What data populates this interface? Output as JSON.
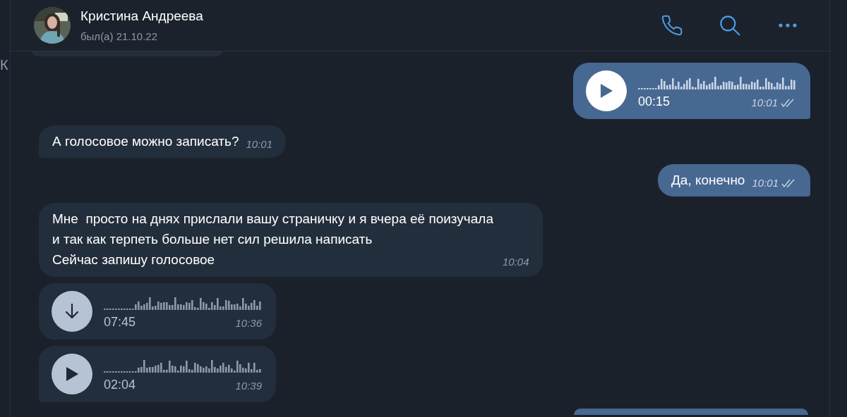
{
  "sidebar": {
    "text": "К"
  },
  "header": {
    "name": "Кристина Андреева",
    "status": "был(а) 21.10.22"
  },
  "messages": [
    {
      "kind": "partial",
      "outgoing": false
    },
    {
      "kind": "voice",
      "outgoing": true,
      "duration": "00:15",
      "time": "10:01",
      "read": true,
      "tail": true
    },
    {
      "kind": "text",
      "outgoing": false,
      "text": "А голосовое можно записать?",
      "time": "10:01",
      "tail": true
    },
    {
      "kind": "text",
      "outgoing": true,
      "text": "Да, конечно",
      "time": "10:01",
      "read": true,
      "tail": true
    },
    {
      "kind": "long",
      "outgoing": false,
      "text": "Мне  просто на днях прислали вашу страничку и я вчера её поизучала и так как терпеть больше нет сил решила написать\nСейчас запишу голосовое",
      "time": "10:04",
      "tail": false
    },
    {
      "kind": "voice_download",
      "outgoing": false,
      "duration": "07:45",
      "time": "10:36",
      "tail": false
    },
    {
      "kind": "voice",
      "outgoing": false,
      "duration": "02:04",
      "time": "10:39",
      "tail": true
    },
    {
      "kind": "partial",
      "outgoing": true
    }
  ]
}
